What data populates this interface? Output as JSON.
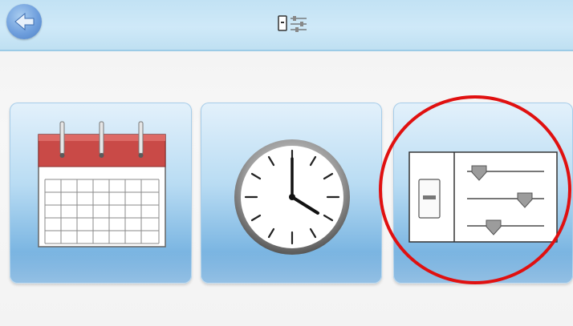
{
  "topbar": {
    "back_icon": "back-arrow-icon",
    "title_icon": "device-settings-icon"
  },
  "tiles": [
    {
      "id": "calendar",
      "icon": "calendar-icon"
    },
    {
      "id": "clock",
      "icon": "clock-icon",
      "time": "4:00"
    },
    {
      "id": "settings",
      "icon": "sliders-settings-icon"
    }
  ],
  "highlight": {
    "shape": "circle",
    "color": "#e01010",
    "target": "settings"
  },
  "colors": {
    "accent": "#4d7fc4",
    "tile_blue": "#7fb8e3",
    "calendar_red": "#c94a47"
  }
}
